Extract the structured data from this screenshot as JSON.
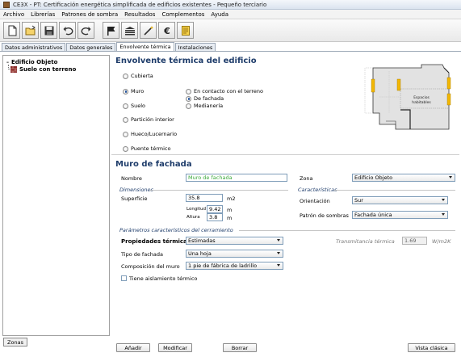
{
  "window": {
    "title": "CE3X - PT: Certificación energética simplificada de edificios existentes - Pequeño terciario"
  },
  "menu": [
    "Archivo",
    "Librerías",
    "Patrones de sombra",
    "Resultados",
    "Complementos",
    "Ayuda"
  ],
  "toolbar": {
    "icons": [
      "new-file-icon",
      "open-folder-icon",
      "save-disk-icon",
      "undo-icon",
      "redo-icon",
      "flag-icon",
      "building-layers-icon",
      "wand-icon",
      "euro-icon",
      "document-icon"
    ]
  },
  "tabs": [
    "Datos administrativos",
    "Datos generales",
    "Envolvente térmica",
    "Instalaciones"
  ],
  "active_tab": "Envolvente térmica",
  "tree": {
    "root": "Edificio Objeto",
    "child": "Suelo con terreno"
  },
  "zonas_button": "Zonas",
  "envolvente": {
    "title": "Envolvente térmica del edificio",
    "types": [
      "Cubierta",
      "Muro",
      "Suelo",
      "Partición interior",
      "Hueco/Lucernario",
      "Puente térmico"
    ],
    "selected_type": "Muro",
    "muro_options": [
      "En contacto con el terreno",
      "De fachada",
      "Medianería"
    ],
    "selected_muro": "De fachada",
    "diagram_label_1": "Espacios",
    "diagram_label_2": "habitables"
  },
  "muro": {
    "title": "Muro de fachada",
    "nombre_label": "Nombre",
    "nombre_value": "Muro de fachada",
    "zona_label": "Zona",
    "zona_value": "Edificio Objeto",
    "dimensiones_label": "Dimensiones",
    "superficie_label": "Superficie",
    "superficie_value": "35.8",
    "superficie_unit": "m2",
    "longitud_label": "Longitud",
    "longitud_value": "9.42",
    "longitud_unit": "m",
    "altura_label": "Altura",
    "altura_value": "3.8",
    "altura_unit": "m",
    "caracteristicas_label": "Características",
    "orientacion_label": "Orientación",
    "orientacion_value": "Sur",
    "patron_label": "Patrón de sombras",
    "patron_value": "Fachada única",
    "parametros_label": "Parámetros característicos del cerramiento",
    "propiedades_label": "Propiedades térmicas",
    "propiedades_value": "Estimadas",
    "transmitancia_label": "Transmitancia térmica",
    "transmitancia_value": "1.69",
    "transmitancia_unit": "W/m2K",
    "tipo_label": "Tipo de fachada",
    "tipo_value": "Una hoja",
    "composicion_label": "Composición del muro",
    "composicion_value": "1 pie de fábrica de ladrillo",
    "aislamiento_label": "Tiene aislamiento térmico"
  },
  "buttons": {
    "anadir": "Añadir",
    "modificar": "Modificar",
    "borrar": "Borrar",
    "vista_clasica": "Vista clásica"
  }
}
